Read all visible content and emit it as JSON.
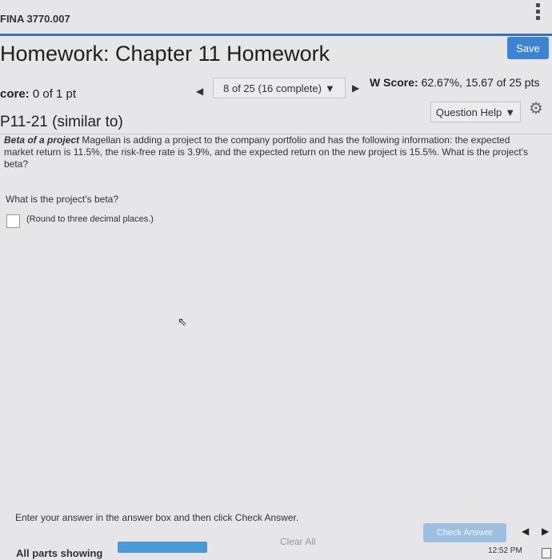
{
  "course": {
    "title": "FINA 3770.007"
  },
  "header": {
    "title": "Homework: Chapter 11 Homework",
    "save_label": "Save"
  },
  "score_row": {
    "score_label": "core:",
    "score_value": "0 of 1 pt",
    "nav_text": "8 of 25 (16 complete)",
    "hw_score_label": "W Score:",
    "hw_score_value": "62.67%, 15.67 of 25 pts"
  },
  "question_row": {
    "number": "P11-21 (similar to)",
    "help_label": "Question Help"
  },
  "problem": {
    "lead": "Beta of a project",
    "text": "Magellan is adding a project to the company portfolio and has the following information: the expected market return is 11.5%, the risk-free rate is 3.9%, and the expected return on the new project is 15.5%. What is the project's beta?",
    "question": "What is the project's beta?",
    "round_note": "(Round to three decimal places.)"
  },
  "footer": {
    "instructions": "Enter your answer in the answer box and then click Check Answer.",
    "all_parts": "All parts showing",
    "clear_all": "Clear All",
    "check_answer": "Check Answer",
    "time": "12:52 PM"
  },
  "icons": {
    "nav_prev": "triangle-left",
    "nav_next": "triangle-right",
    "dropdown": "triangle-down",
    "settings": "gear",
    "menu": "kebab"
  },
  "colors": {
    "accent": "#3b73b9",
    "save_button": "#3d83d1",
    "progress": "#4a9ad8",
    "check_answer_disabled": "#9fbfe0"
  }
}
